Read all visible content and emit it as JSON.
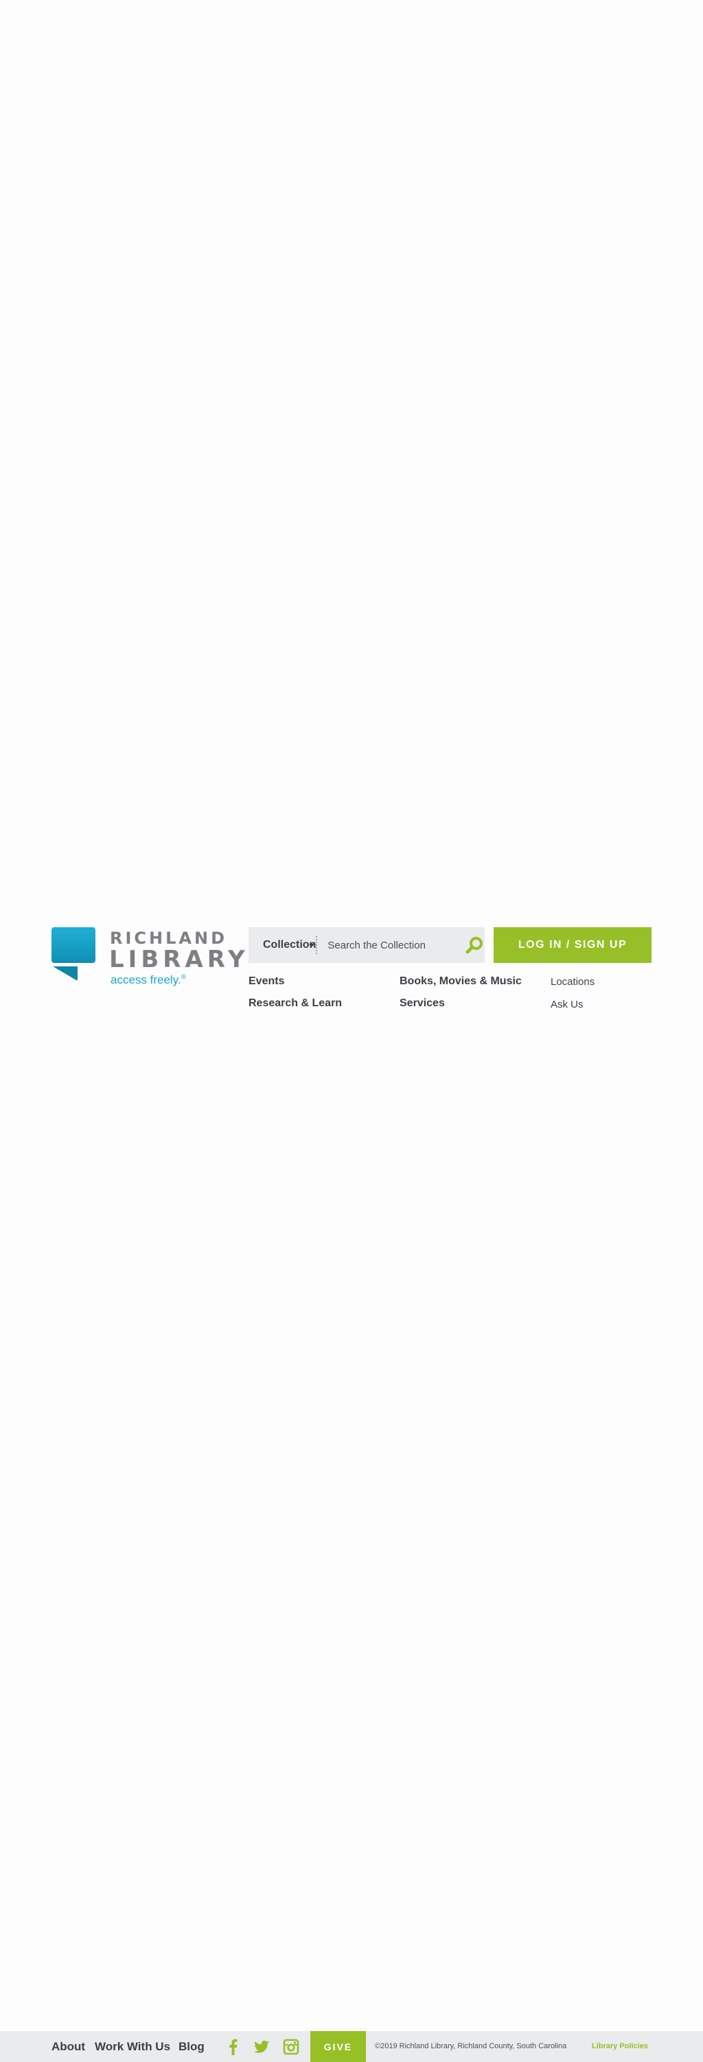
{
  "colors": {
    "brand_green": "#97bf27",
    "brand_blue": "#19a7c9",
    "text_dark": "#3b3f45",
    "logo_gray": "#7d7f82",
    "panel_gray": "#e9ebed"
  },
  "logo": {
    "line1": "RICHLAND",
    "line2": "LIBRARY",
    "tagline": "access freely.",
    "tagline_mark": "®",
    "icon": "library-logo-mark"
  },
  "search": {
    "scope_label": "Collection",
    "placeholder": "Search the Collection",
    "value": "",
    "icon": "search-icon"
  },
  "login": {
    "label": "LOG IN / SIGN UP"
  },
  "nav": {
    "primary": [
      "Events",
      "Books, Movies & Music",
      "Research & Learn",
      "Services"
    ],
    "secondary": [
      "Locations",
      "Ask Us"
    ]
  },
  "footer": {
    "links": [
      "About",
      "Work With Us",
      "Blog"
    ],
    "social_icons": [
      "facebook-icon",
      "twitter-icon",
      "instagram-icon"
    ],
    "give_label": "GIVE",
    "copyright": "©2019 Richland Library, Richland County, South Carolina",
    "policies_label": "Library Policies"
  }
}
